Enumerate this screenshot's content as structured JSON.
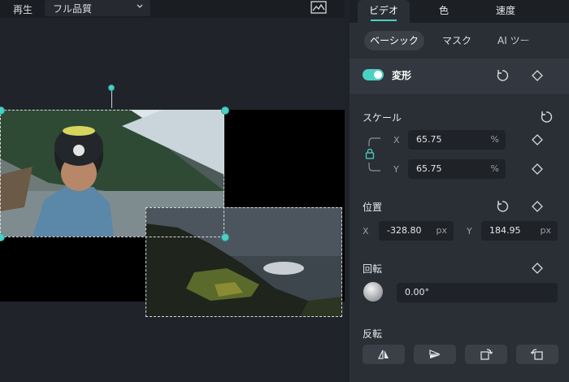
{
  "toolbar": {
    "play_label": "再生",
    "quality_label": "フル品質"
  },
  "tabs": [
    {
      "label": "ビデオ"
    },
    {
      "label": "色"
    },
    {
      "label": "速度"
    }
  ],
  "subtabs": [
    {
      "label": "ベーシック"
    },
    {
      "label": "マスク"
    },
    {
      "label": "AI ツー"
    }
  ],
  "transform": {
    "label": "変形",
    "enabled": true
  },
  "scale": {
    "label": "スケール",
    "x_axis": "X",
    "y_axis": "Y",
    "x_value": "65.75",
    "y_value": "65.75",
    "unit": "%"
  },
  "position": {
    "label": "位置",
    "x_axis": "X",
    "y_axis": "Y",
    "x_value": "-328.80",
    "y_value": "184.95",
    "unit": "px"
  },
  "rotate": {
    "label": "回転",
    "value": "0.00°"
  },
  "flip": {
    "label": "反転"
  },
  "colors": {
    "accent": "#4ad1c3",
    "panel_bg": "#2a2e35",
    "preview_bg": "#20242a"
  }
}
